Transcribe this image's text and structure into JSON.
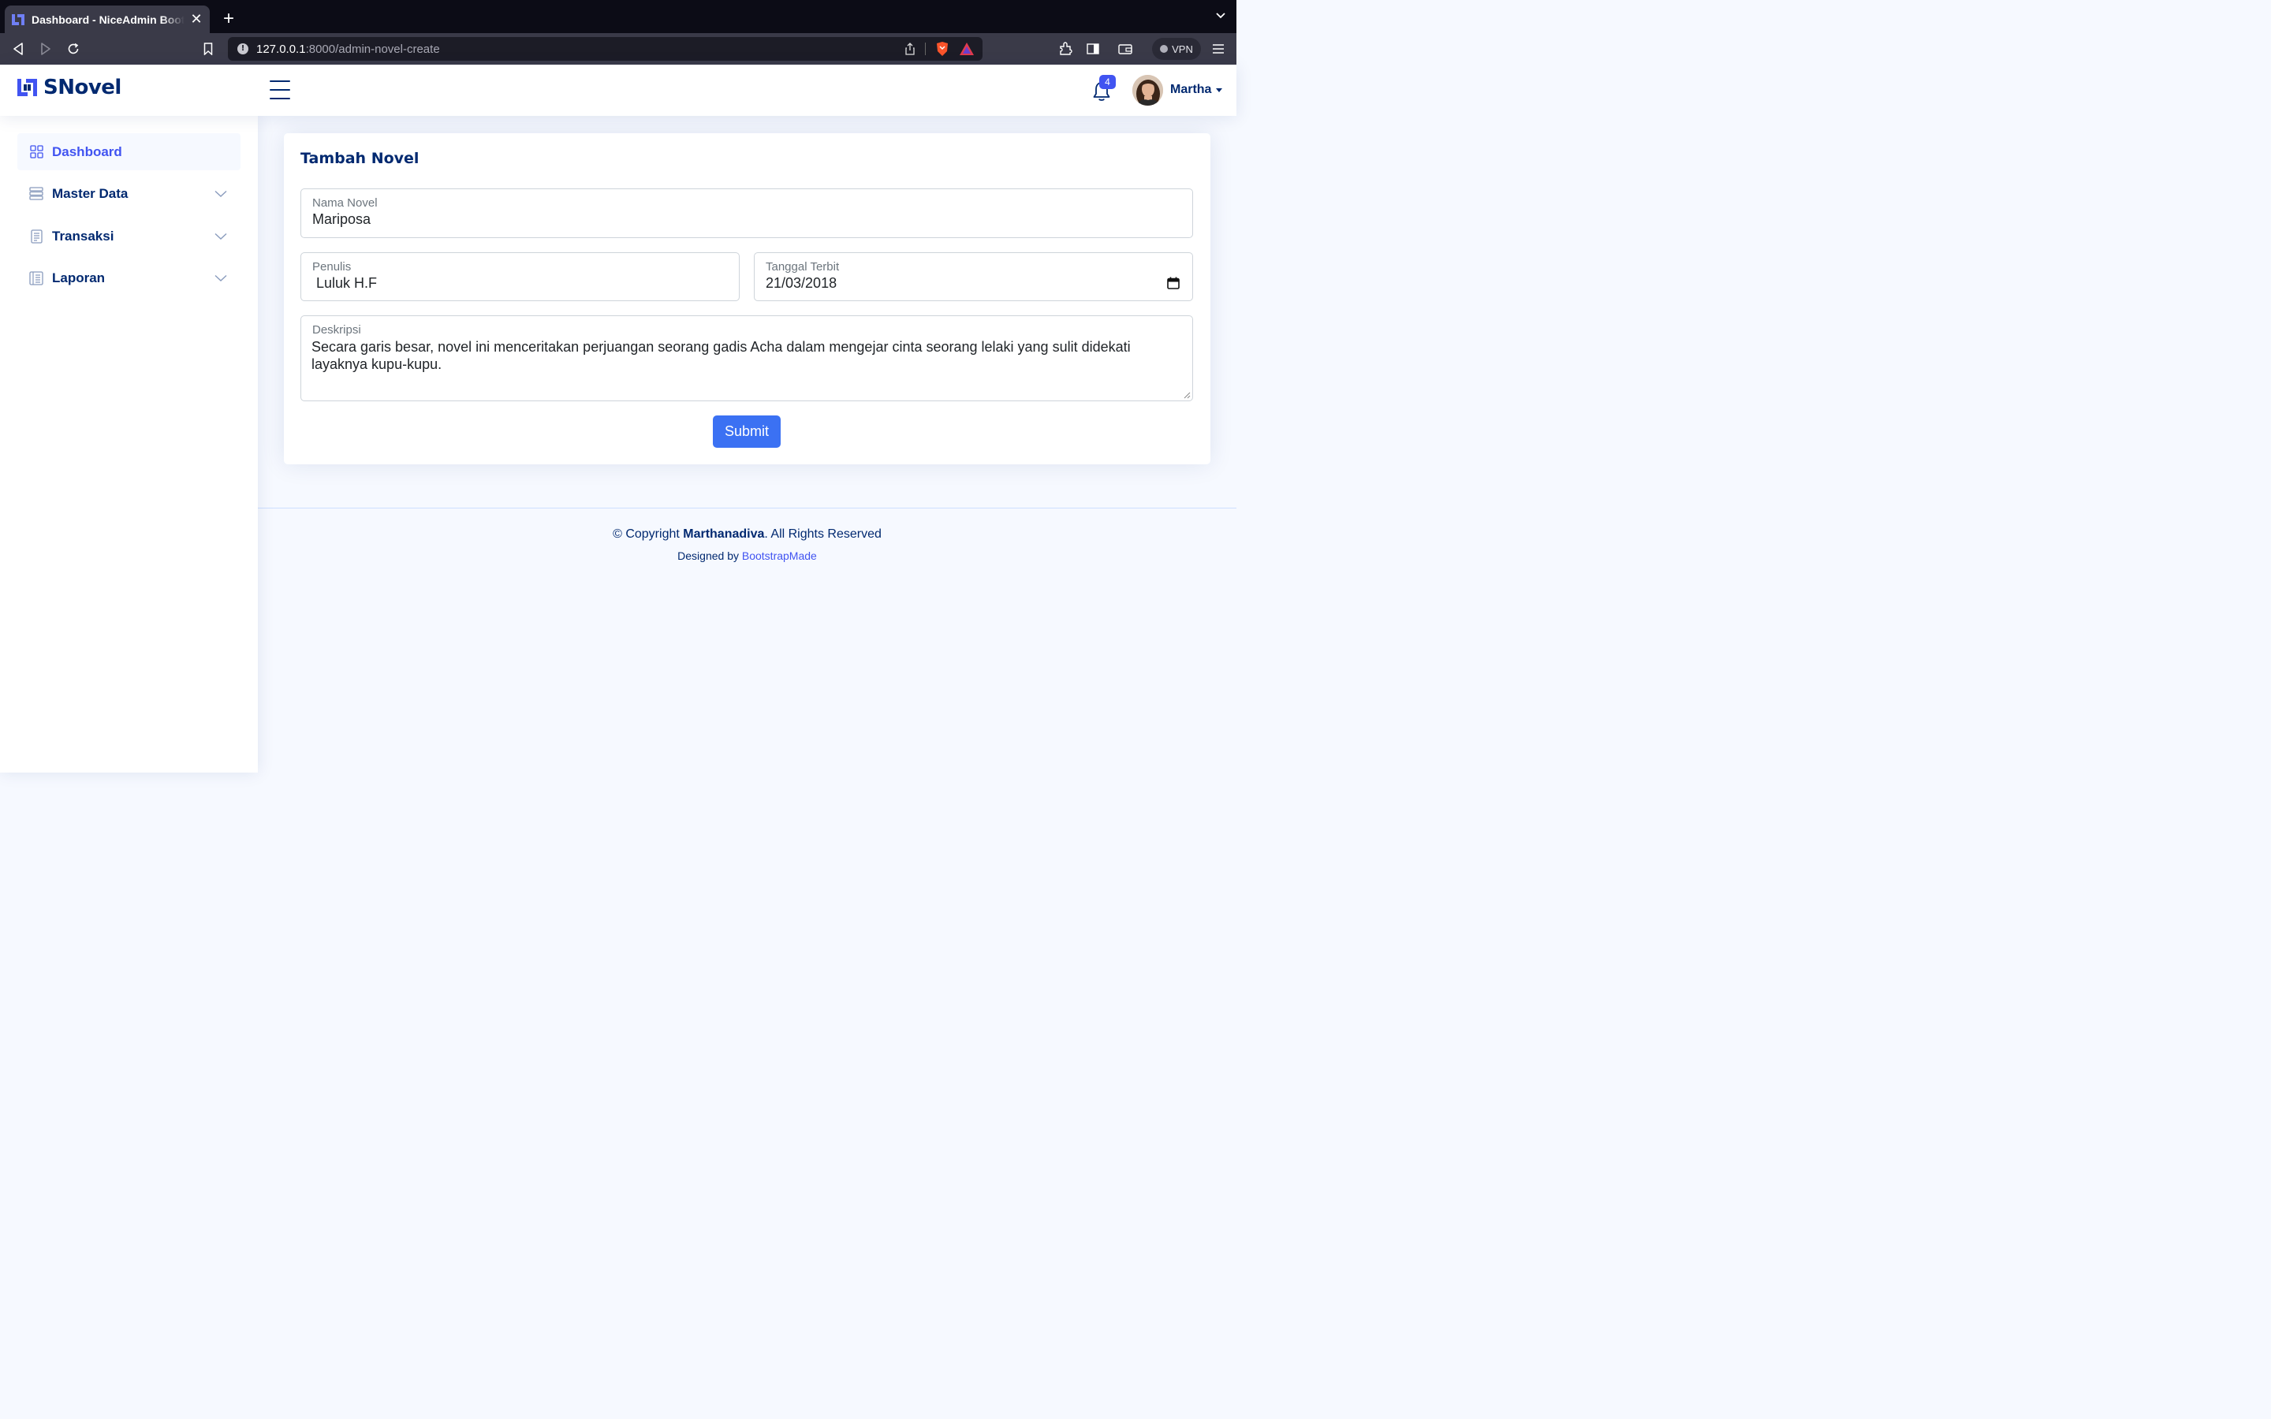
{
  "browser": {
    "tab_title": "Dashboard - NiceAdmin Bootstrap Template",
    "url_host": "127.0.0.1",
    "url_path": ":8000/admin-novel-create",
    "vpn_label": "VPN"
  },
  "header": {
    "brand": "SNovel",
    "notification_count": "4",
    "user_name": "Martha"
  },
  "sidebar": {
    "items": [
      {
        "label": "Dashboard",
        "icon": "grid-icon",
        "active": true
      },
      {
        "label": "Master Data",
        "icon": "database-icon",
        "expandable": true
      },
      {
        "label": "Transaksi",
        "icon": "receipt-icon",
        "expandable": true
      },
      {
        "label": "Laporan",
        "icon": "report-icon",
        "expandable": true
      }
    ]
  },
  "form": {
    "title": "Tambah Novel",
    "nama_novel": {
      "label": "Nama Novel",
      "value": "Mariposa"
    },
    "penulis": {
      "label": "Penulis",
      "value": " Luluk H.F"
    },
    "tanggal_terbit": {
      "label": "Tanggal Terbit",
      "value": "21/03/2018"
    },
    "deskripsi": {
      "label": "Deskripsi",
      "value": "Secara garis besar, novel ini menceritakan perjuangan seorang gadis Acha dalam mengejar cinta seorang lelaki yang sulit didekati layaknya kupu-kupu."
    },
    "submit_label": "Submit"
  },
  "footer": {
    "copyright_prefix": "© Copyright ",
    "copyright_owner": "Marthanadiva",
    "copyright_suffix": ". All Rights Reserved",
    "designed_by": "Designed by ",
    "designer": "BootstrapMade"
  },
  "colors": {
    "brand": "#012970",
    "accent": "#4154f1",
    "button": "#3b71f3"
  }
}
